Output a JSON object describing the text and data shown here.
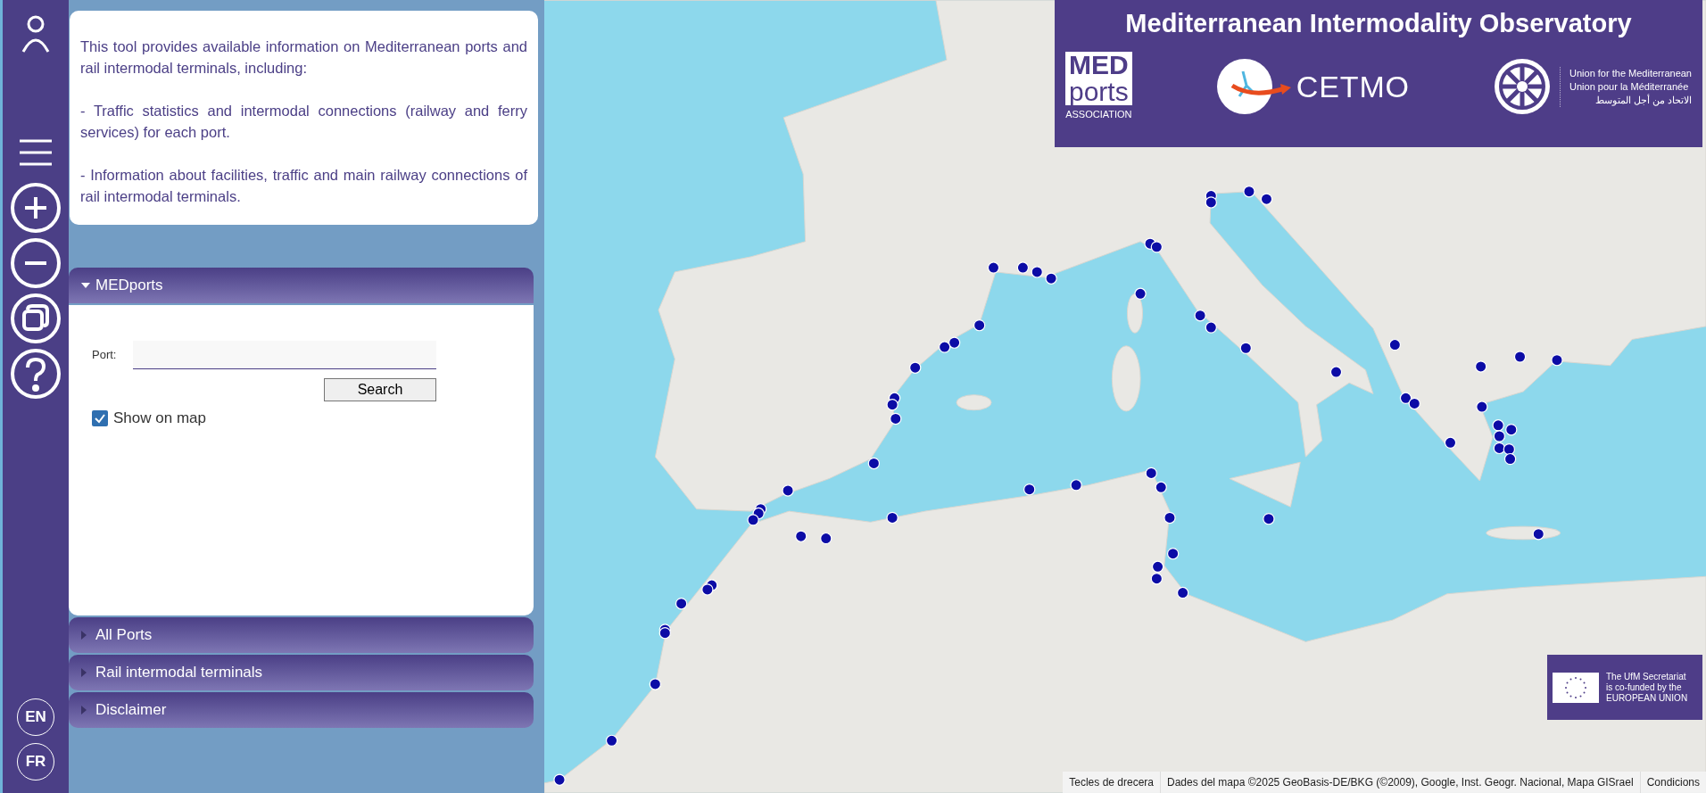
{
  "sidebar": {
    "languages": [
      {
        "label": "EN"
      },
      {
        "label": "FR"
      }
    ]
  },
  "info_card": {
    "paragraphs": [
      "This tool provides available information on Mediterranean ports and rail intermodal terminals, including:",
      "- Traffic statistics and intermodal connections (railway and ferry services) for each port.",
      "- Information about facilities, traffic and main railway connections of rail intermodal terminals."
    ]
  },
  "accordion": [
    {
      "title": "MEDports",
      "expanded": true
    },
    {
      "title": "All Ports",
      "expanded": false
    },
    {
      "title": "Rail intermodal terminals",
      "expanded": false
    },
    {
      "title": "Disclaimer",
      "expanded": false
    }
  ],
  "port_search": {
    "label": "Port:",
    "button": "Search",
    "show_on_map": {
      "label": "Show on map",
      "checked": true
    }
  },
  "header": {
    "title": "Mediterranean Intermodality Observatory",
    "medports_logo": [
      "MED",
      "ports",
      "ASSOCIATION"
    ],
    "cetmo_logo": "CETMO",
    "ufm_logo": [
      "Union for the Mediterranean",
      "Union pour la Méditerranée",
      "الاتحاد من أجل المتوسط"
    ]
  },
  "eu_notice": [
    "The UfM Secretariat",
    "is co-funded by the",
    "EUROPEAN UNION"
  ],
  "attribution": [
    "Tecles de drecera",
    "Dades del mapa ©2025 GeoBasis-DE/BKG (©2009), Google, Inst. Geogr. Nacional, Mapa GISrael",
    "Condicions"
  ]
}
